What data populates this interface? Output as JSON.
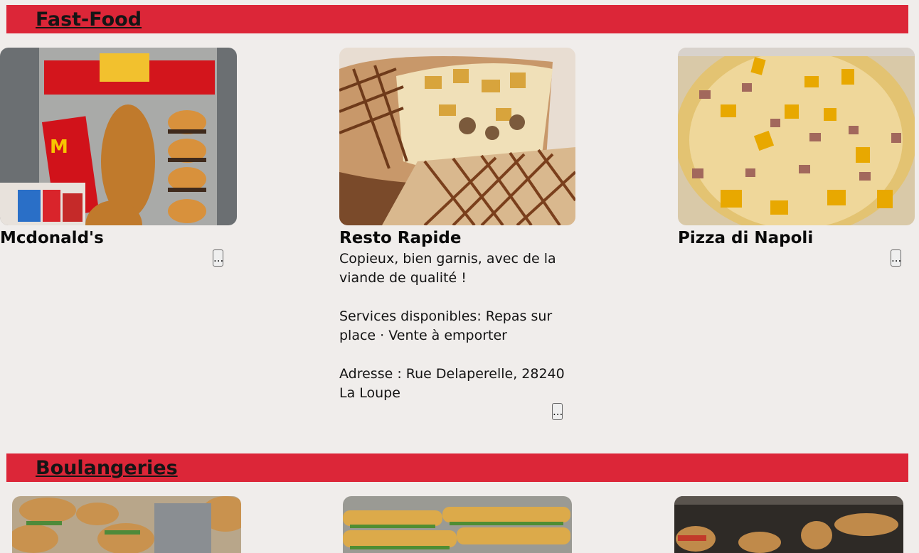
{
  "sections": [
    {
      "title": "Fast-Food",
      "cards": [
        {
          "name": "Mcdonald's",
          "image": "mcdonalds-food-tray-image",
          "more_label": "..."
        },
        {
          "name": "Resto Rapide",
          "image": "tacos-wrap-image",
          "description": [
            "Copieux, bien garnis, avec de la viande de qualité !",
            "Services disponibles: Repas sur place · Vente à emporter",
            "Adresse : Rue Delaperelle, 28240 La Loupe"
          ],
          "more_label": "..."
        },
        {
          "name": "Pizza di Napoli",
          "image": "pizza-image",
          "more_label": "..."
        }
      ]
    },
    {
      "title": "Boulangeries",
      "cards": [
        {
          "image": "sandwiches-image"
        },
        {
          "image": "baguette-sandwiches-image"
        },
        {
          "image": "bakery-display-image"
        }
      ]
    }
  ],
  "colors": {
    "header_bg": "#dc2638",
    "page_bg": "#f0edeb"
  }
}
